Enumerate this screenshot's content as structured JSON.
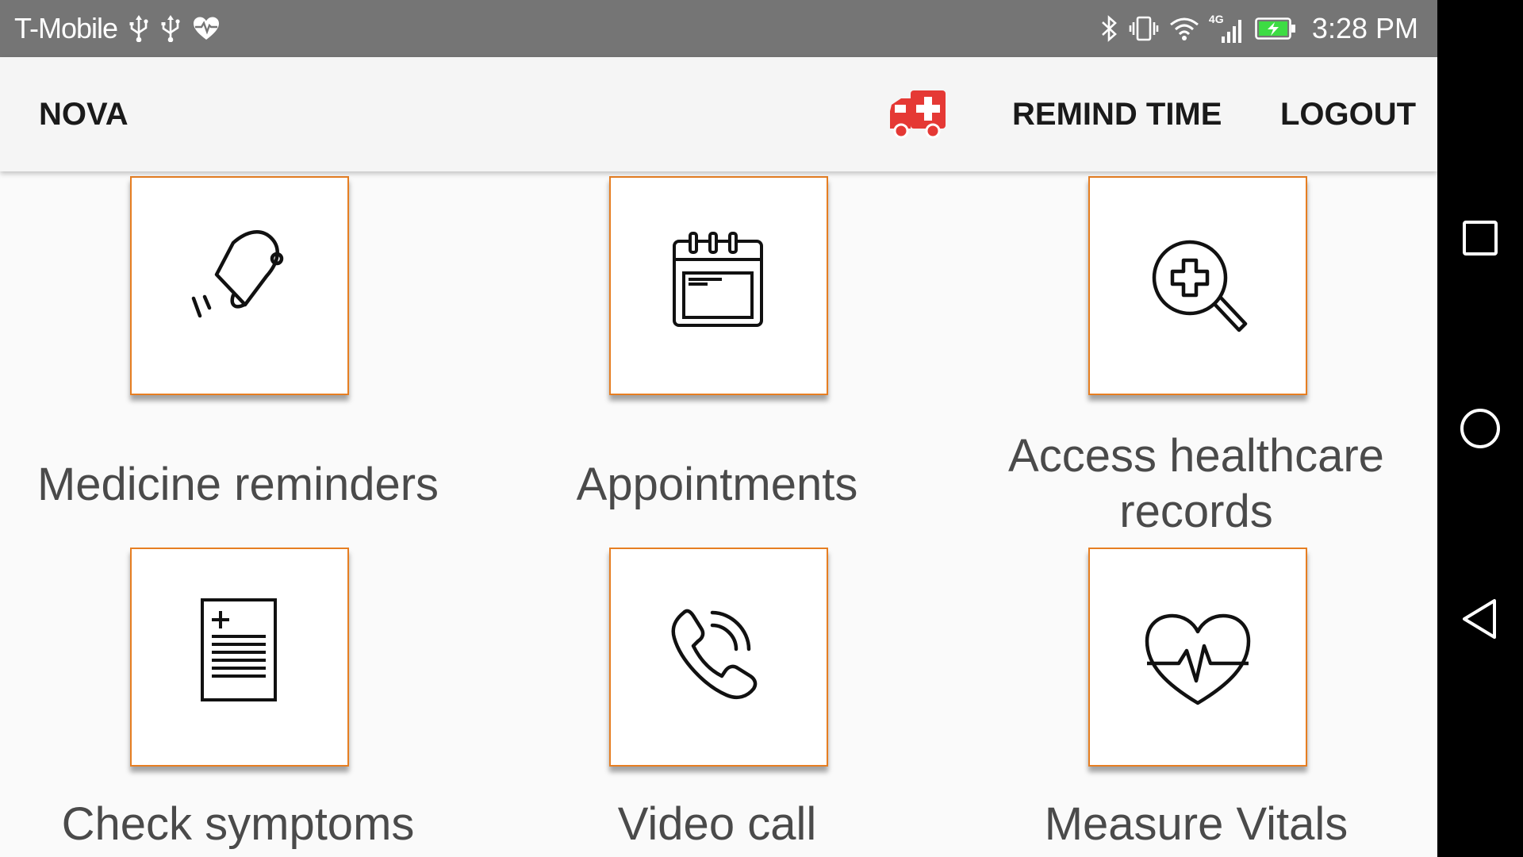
{
  "status_bar": {
    "carrier": "T-Mobile",
    "network": "4G",
    "time": "3:28 PM",
    "left_icons": [
      "usb-icon",
      "usb-icon",
      "heart-monitor-icon"
    ],
    "right_icons": [
      "bluetooth-icon",
      "vibrate-icon",
      "wifi-icon",
      "signal-icon",
      "battery-charging-icon"
    ],
    "battery_color": "#3ddc43"
  },
  "app_bar": {
    "title": "NOVA",
    "emergency_icon": "ambulance-icon",
    "emergency_color": "#e53935",
    "remind_time": "REMIND TIME",
    "logout": "LOGOUT"
  },
  "accent_color": "#e67e22",
  "tiles": [
    {
      "label": "Medicine reminders",
      "icon": "bell-icon"
    },
    {
      "label": "Appointments",
      "icon": "calendar-icon"
    },
    {
      "label_lines": [
        "Access healthcare",
        "records"
      ],
      "icon": "medical-search-icon"
    },
    {
      "label": "Check symptoms",
      "icon": "medical-document-icon"
    },
    {
      "label": "Video call",
      "icon": "phone-icon"
    },
    {
      "label": "Measure Vitals",
      "icon": "heartbeat-icon"
    }
  ],
  "nav_bar": {
    "buttons": [
      "recents-square-icon",
      "home-circle-icon",
      "back-triangle-icon"
    ]
  }
}
